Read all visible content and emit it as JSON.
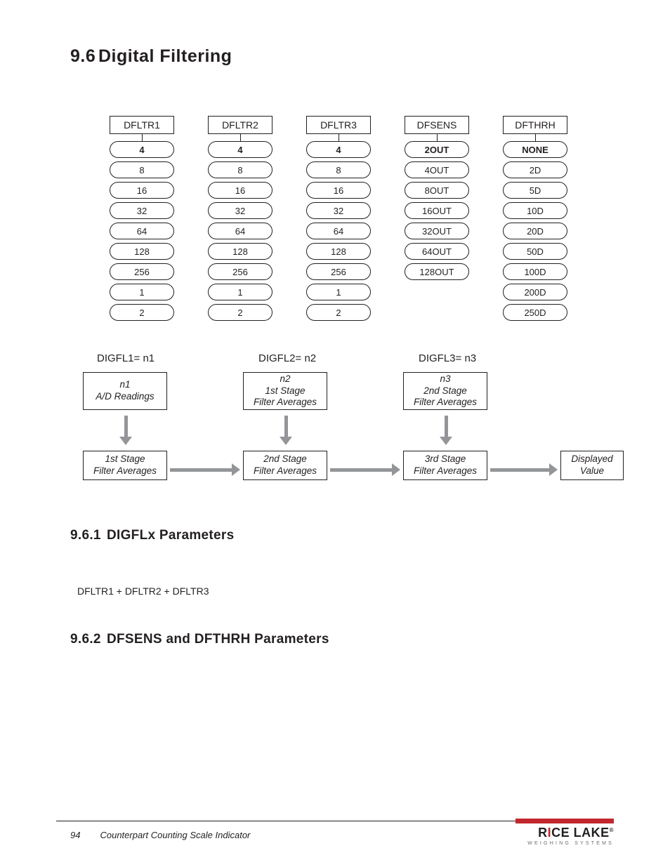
{
  "section": {
    "number": "9.6",
    "title": "Digital Filtering"
  },
  "columns": [
    {
      "header": "DFLTR1",
      "options": [
        "4",
        "8",
        "16",
        "32",
        "64",
        "128",
        "256",
        "1",
        "2"
      ],
      "bold_index": 0
    },
    {
      "header": "DFLTR2",
      "options": [
        "4",
        "8",
        "16",
        "32",
        "64",
        "128",
        "256",
        "1",
        "2"
      ],
      "bold_index": 0
    },
    {
      "header": "DFLTR3",
      "options": [
        "4",
        "8",
        "16",
        "32",
        "64",
        "128",
        "256",
        "1",
        "2"
      ],
      "bold_index": 0
    },
    {
      "header": "DFSENS",
      "options": [
        "2OUT",
        "4OUT",
        "8OUT",
        "16OUT",
        "32OUT",
        "64OUT",
        "128OUT"
      ],
      "bold_index": 0
    },
    {
      "header": "DFTHRH",
      "options": [
        "NONE",
        "2D",
        "5D",
        "10D",
        "20D",
        "50D",
        "100D",
        "200D",
        "250D"
      ],
      "bold_index": 0
    }
  ],
  "flow": {
    "labels": [
      "DIGFL1= n1",
      "DIGFL2= n2",
      "DIGFL3= n3"
    ],
    "top_boxes": [
      [
        "n1",
        "A/D Readings"
      ],
      [
        "n2",
        "1st Stage",
        "Filter Averages"
      ],
      [
        "n3",
        "2nd Stage",
        "Filter Averages"
      ]
    ],
    "bot_boxes": [
      [
        "1st Stage",
        "Filter Averages"
      ],
      [
        "2nd Stage",
        "Filter Averages"
      ],
      [
        "3rd Stage",
        "Filter Averages"
      ]
    ],
    "display_box": [
      "Displayed",
      "Value"
    ]
  },
  "sub1": {
    "number": "9.6.1",
    "title": "DIGFLx Parameters"
  },
  "formula": "DFLTR1 + DFLTR2 + DFLTR3",
  "sub2": {
    "number": "9.6.2",
    "title": "DFSENS and DFTHRH Parameters"
  },
  "footer": {
    "page": "94",
    "doc": "Counterpart Counting Scale Indicator"
  },
  "logo": {
    "name_pre": "R",
    "name_i": "I",
    "name_mid": "CE LAKE",
    "sub": "WEIGHING SYSTEMS"
  }
}
